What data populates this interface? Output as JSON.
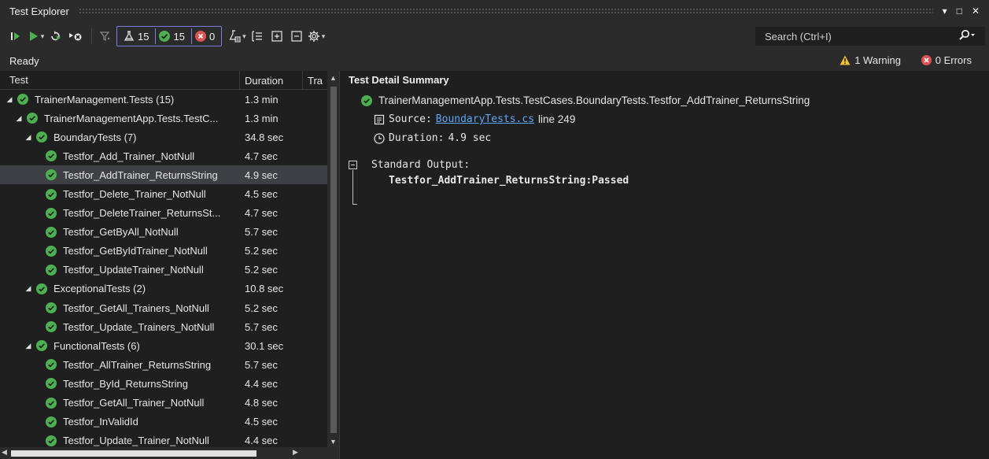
{
  "window": {
    "title": "Test Explorer",
    "controls": {
      "dropdown": "▾",
      "maximize": "□",
      "close": "✕"
    }
  },
  "toolbar": {
    "run_all": "Run All Tests",
    "run": "Run",
    "repeat_last": "Repeat Last Run",
    "cancel": "Cancel",
    "filter": "Filter",
    "counters": {
      "total": "15",
      "passed": "15",
      "failed": "0"
    },
    "search_placeholder": "Search (Ctrl+I)"
  },
  "status": {
    "text": "Ready",
    "warnings": "1 Warning",
    "errors": "0 Errors"
  },
  "tree": {
    "columns": {
      "test": "Test",
      "duration": "Duration",
      "traits": "Tra"
    },
    "rows": [
      {
        "level": 0,
        "expanded": true,
        "label": "TrainerManagement.Tests (15)",
        "duration": "1.3 min",
        "selected": false
      },
      {
        "level": 1,
        "expanded": true,
        "label": "TrainerManagementApp.Tests.TestC...",
        "duration": "1.3 min",
        "selected": false
      },
      {
        "level": 2,
        "expanded": true,
        "label": "BoundaryTests (7)",
        "duration": "34.8 sec",
        "selected": false
      },
      {
        "level": 3,
        "expanded": null,
        "label": "Testfor_Add_Trainer_NotNull",
        "duration": "4.7 sec",
        "selected": false
      },
      {
        "level": 3,
        "expanded": null,
        "label": "Testfor_AddTrainer_ReturnsString",
        "duration": "4.9 sec",
        "selected": true
      },
      {
        "level": 3,
        "expanded": null,
        "label": "Testfor_Delete_Trainer_NotNull",
        "duration": "4.5 sec",
        "selected": false
      },
      {
        "level": 3,
        "expanded": null,
        "label": "Testfor_DeleteTrainer_ReturnsSt...",
        "duration": "4.7 sec",
        "selected": false
      },
      {
        "level": 3,
        "expanded": null,
        "label": "Testfor_GetByAll_NotNull",
        "duration": "5.7 sec",
        "selected": false
      },
      {
        "level": 3,
        "expanded": null,
        "label": "Testfor_GetByIdTrainer_NotNull",
        "duration": "5.2 sec",
        "selected": false
      },
      {
        "level": 3,
        "expanded": null,
        "label": "Testfor_UpdateTrainer_NotNull",
        "duration": "5.2 sec",
        "selected": false
      },
      {
        "level": 2,
        "expanded": true,
        "label": "ExceptionalTests (2)",
        "duration": "10.8 sec",
        "selected": false
      },
      {
        "level": 3,
        "expanded": null,
        "label": "Testfor_GetAll_Trainers_NotNull",
        "duration": "5.2 sec",
        "selected": false
      },
      {
        "level": 3,
        "expanded": null,
        "label": "Testfor_Update_Trainers_NotNull",
        "duration": "5.7 sec",
        "selected": false
      },
      {
        "level": 2,
        "expanded": true,
        "label": "FunctionalTests (6)",
        "duration": "30.1 sec",
        "selected": false
      },
      {
        "level": 3,
        "expanded": null,
        "label": "Testfor_AllTrainer_ReturnsString",
        "duration": "5.7 sec",
        "selected": false
      },
      {
        "level": 3,
        "expanded": null,
        "label": "Testfor_ById_ReturnsString",
        "duration": "4.4 sec",
        "selected": false
      },
      {
        "level": 3,
        "expanded": null,
        "label": "Testfor_GetAll_Trainer_NotNull",
        "duration": "4.8 sec",
        "selected": false
      },
      {
        "level": 3,
        "expanded": null,
        "label": "Testfor_InValidId",
        "duration": "4.5 sec",
        "selected": false
      },
      {
        "level": 3,
        "expanded": null,
        "label": "Testfor_Update_Trainer_NotNull",
        "duration": "4.4 sec",
        "selected": false
      }
    ]
  },
  "details": {
    "header": "Test Detail Summary",
    "full_name": "TrainerManagementApp.Tests.TestCases.BoundaryTests.Testfor_AddTrainer_ReturnsString",
    "source_label": "Source:",
    "source_file": "BoundaryTests.cs",
    "source_line": "line 249",
    "duration_label": "Duration:",
    "duration_value": "4.9 sec",
    "std_output_label": "Standard Output:",
    "std_output_text": "Testfor_AddTrainer_ReturnsString:Passed"
  },
  "colors": {
    "background": "#1f1f1f",
    "chrome": "#2b2b2b",
    "pass": "#4cb050",
    "fail": "#e05252",
    "warning": "#f2c12e",
    "link": "#5aa7f5",
    "counter_border": "#7d7de0",
    "selected_row": "#3f3f46"
  },
  "icons": {
    "run_all": "run-all-icon",
    "run": "run-icon",
    "repeat": "repeat-icon",
    "cancel": "cancel-icon",
    "filter": "filter-icon",
    "flask": "flask-icon",
    "pass": "pass-check-icon",
    "fail": "fail-x-icon",
    "playlist": "playlist-icon",
    "group_by": "group-by-icon",
    "expand_all": "expand-all-icon",
    "collapse_all": "collapse-all-icon",
    "settings": "gear-icon",
    "search": "search-icon",
    "warning": "warning-icon",
    "error": "error-icon",
    "source": "document-icon",
    "duration": "clock-icon"
  }
}
